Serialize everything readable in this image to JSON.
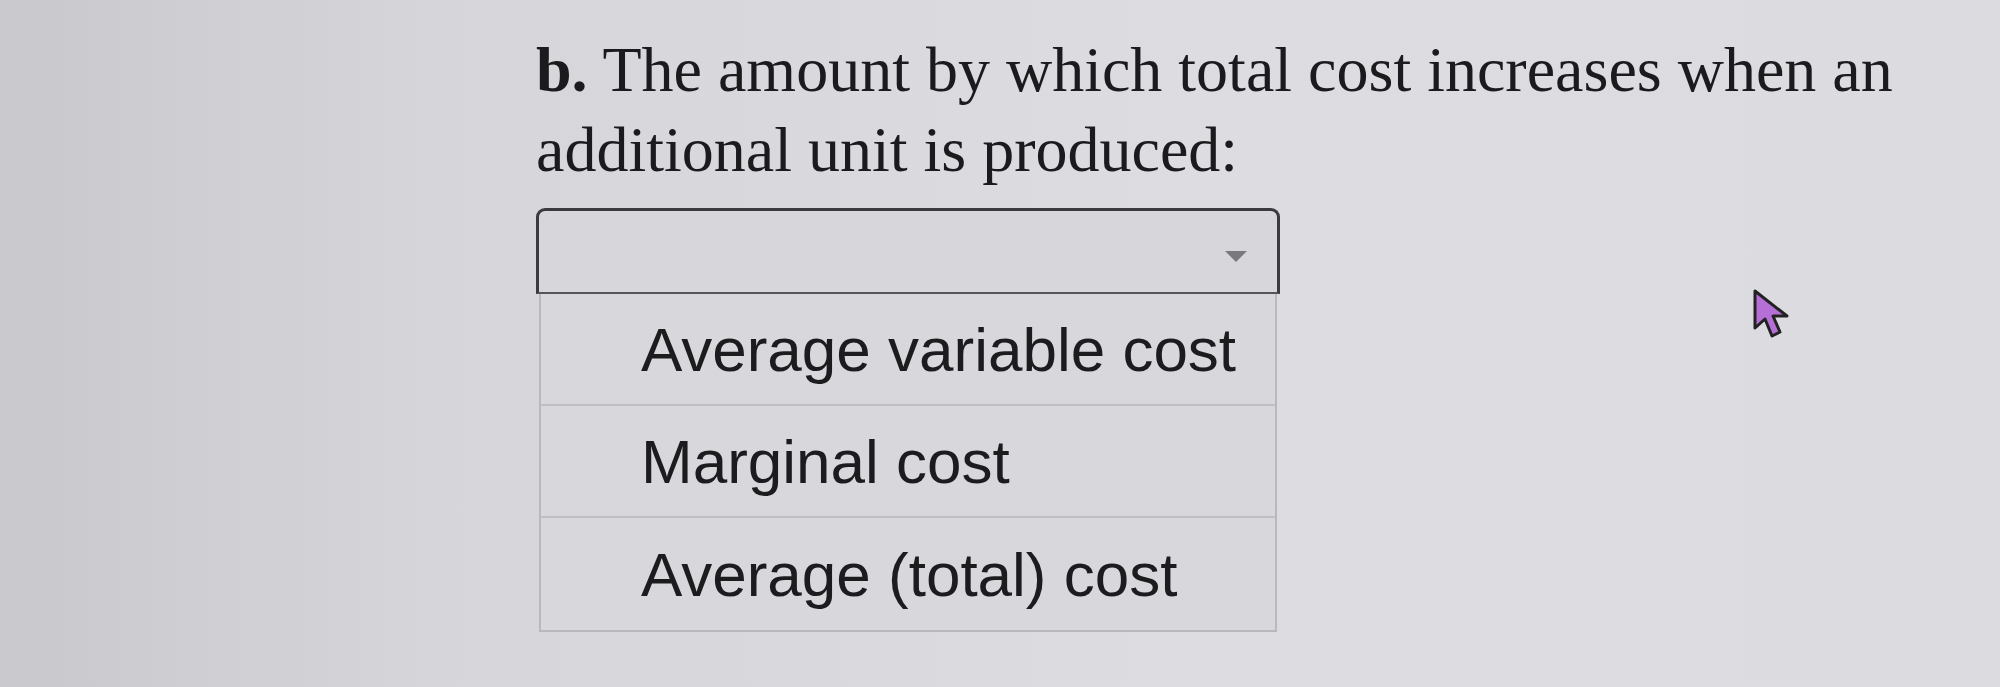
{
  "question": {
    "text": "**b.** The amount by which total cost increases when an additional unit is produced:"
  },
  "dropdown": {
    "expanded": true,
    "options": [
      {
        "label": "Average variable cost",
        "selected": false
      },
      {
        "label": "Marginal cost",
        "selected": false
      },
      {
        "label": "Average (total) cost",
        "selected": false
      }
    ]
  }
}
